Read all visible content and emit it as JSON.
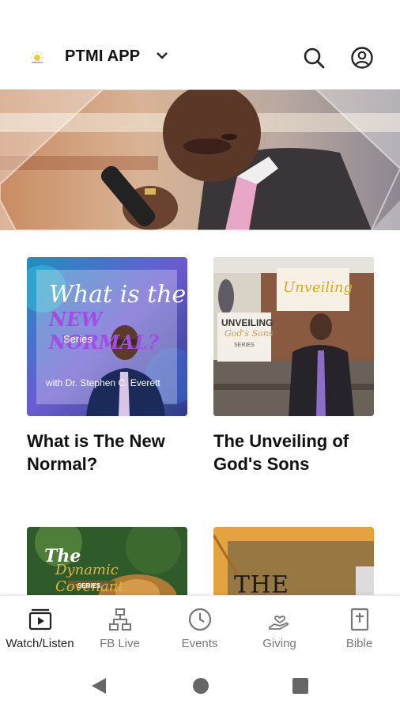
{
  "header": {
    "app_title": "PTMI APP",
    "logo_icon": "sun-logo-icon",
    "search_icon": "search-icon",
    "account_icon": "account-circle-icon"
  },
  "hero": {
    "image_desc": "preacher-with-microphone"
  },
  "series": [
    {
      "title": "What is The New Normal?",
      "art_line1": "What is the",
      "art_line2": "NEW NORMAL?",
      "art_line3": "Series",
      "art_line4": "with Dr. Stephen C. Everett"
    },
    {
      "title": "The Unveiling of God's Sons",
      "art_screen": "Unveiling",
      "art_sign1": "UNVEILING",
      "art_sign2": "God's Sons",
      "art_sign3": "SERIES"
    },
    {
      "title": "",
      "art_line1": "The",
      "art_line2": "Dynamic Covenant",
      "art_line3": "SERIES"
    },
    {
      "title": "",
      "art_line1": "THE DECADE"
    }
  ],
  "bottom_nav": [
    {
      "label": "Watch/Listen",
      "icon": "play-video-icon",
      "active": true
    },
    {
      "label": "FB Live",
      "icon": "hierarchy-icon",
      "active": false
    },
    {
      "label": "Events",
      "icon": "clock-icon",
      "active": false
    },
    {
      "label": "Giving",
      "icon": "hand-heart-icon",
      "active": false
    },
    {
      "label": "Bible",
      "icon": "bible-icon",
      "active": false
    }
  ],
  "system_nav": [
    "back-icon",
    "home-icon",
    "recents-icon"
  ],
  "colors": {
    "accent": "#111111",
    "nav_inactive": "#777777",
    "new_normal_purple": "#9b3fe0",
    "unveiling_gold": "#d6a829"
  }
}
